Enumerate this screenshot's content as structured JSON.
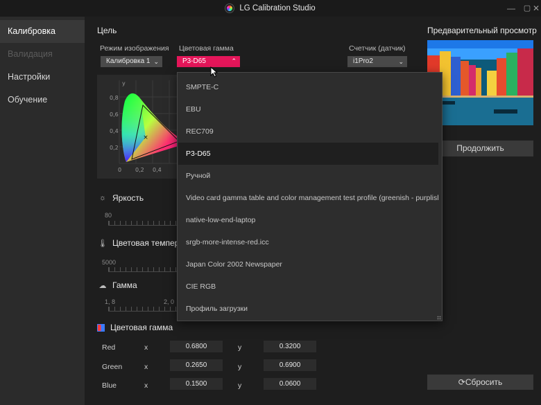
{
  "window": {
    "title": "LG Calibration Studio",
    "minimize_glyph": "—",
    "maximize_glyph": "▢",
    "close_glyph": "✕"
  },
  "sidebar": {
    "items": [
      {
        "label": "Калибровка",
        "state": "active"
      },
      {
        "label": "Валидация",
        "state": "disabled"
      },
      {
        "label": "Настройки",
        "state": "normal"
      },
      {
        "label": "Обучение",
        "state": "normal"
      }
    ]
  },
  "target": {
    "title": "Цель",
    "image_mode": {
      "label": "Режим изображения",
      "value": "Калибровка 1"
    },
    "color_gamut": {
      "label": "Цветовая гамма",
      "value": "P3-D65"
    },
    "sensor": {
      "label": "Счетчик (датчик)",
      "value": "i1Pro2"
    }
  },
  "cie_chart": {
    "y_axis_label": "y",
    "y_ticks": [
      "0,8",
      "0,6",
      "0,4",
      "0,2"
    ],
    "x_ticks": [
      "0",
      "0,2",
      "0,4"
    ]
  },
  "settings": {
    "brightness": {
      "label": "Яркость",
      "scale_start": "80"
    },
    "color_temperature": {
      "label": "Цветовая темпера",
      "scale_start": "5000"
    },
    "gamma": {
      "label": "Гамма",
      "scale_start": "1, 8",
      "scale_mid": "2, 0"
    }
  },
  "gamut_table": {
    "title": "Цветовая гамма",
    "x_label": "x",
    "y_label": "y",
    "rows": [
      {
        "name": "Red",
        "x": "0.6800",
        "y": "0.3200"
      },
      {
        "name": "Green",
        "x": "0.2650",
        "y": "0.6900"
      },
      {
        "name": "Blue",
        "x": "0.1500",
        "y": "0.0600"
      }
    ]
  },
  "preview": {
    "title": "Предварительный просмотр",
    "continue_label": "Продолжить",
    "reset_label": "Сбросить"
  },
  "dropdown": {
    "selected_index": 3,
    "options": [
      "SMPTE-C",
      "EBU",
      "REC709",
      "P3-D65",
      "Ручной",
      "Video card gamma table and color management test profile (greenish - purplish)",
      "native-low-end-laptop",
      "srgb-more-intense-red.icc",
      "Japan Color 2002 Newspaper",
      "CIE RGB",
      "Профиль загрузки"
    ]
  },
  "colors": {
    "accent": "#e5165a",
    "sidebar_bg": "#2b2b2b",
    "main_bg": "#1e1e1e"
  }
}
